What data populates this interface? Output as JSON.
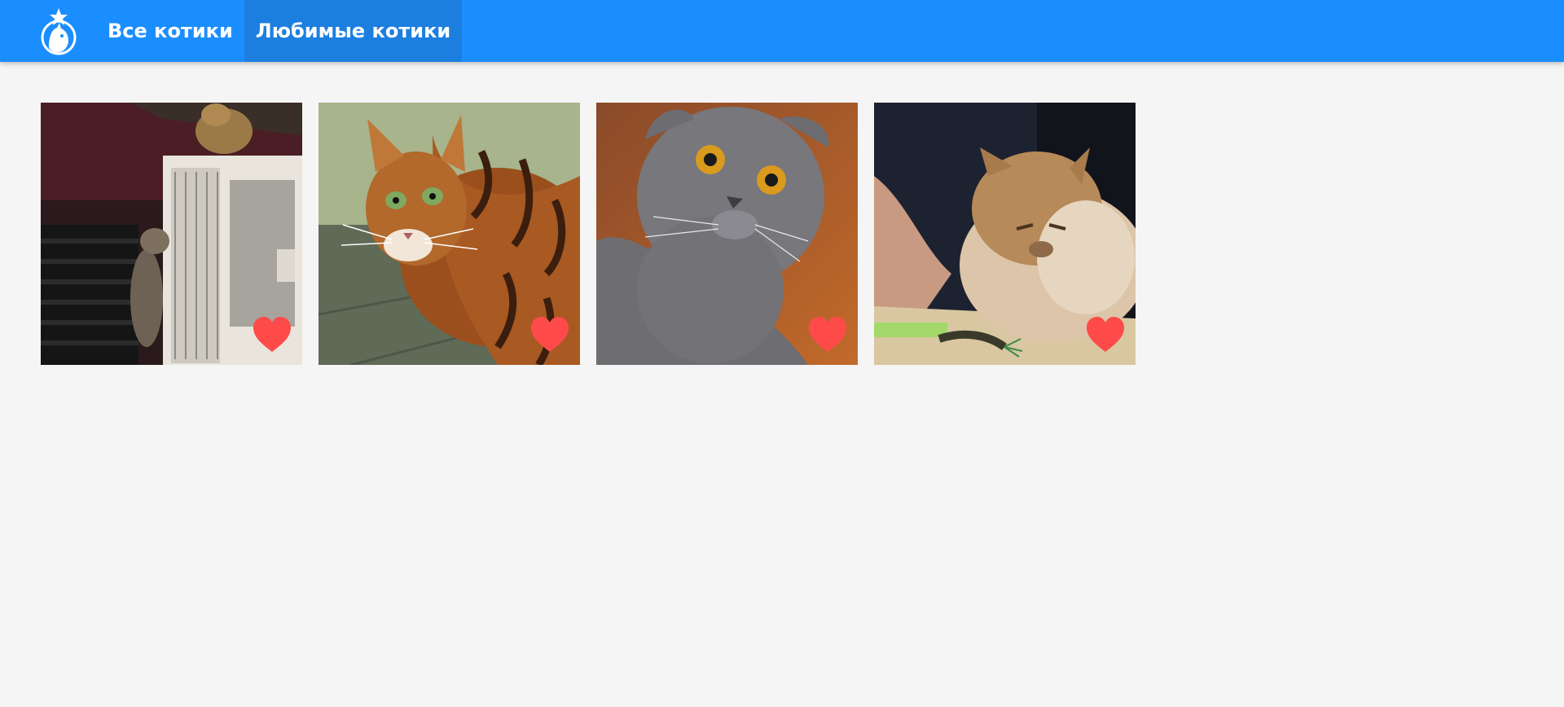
{
  "header": {
    "logo_icon": "cat-dog-star-logo-icon",
    "tabs": [
      {
        "label": "Все котики",
        "active": false
      },
      {
        "label": "Любимые котики",
        "active": true
      }
    ]
  },
  "colors": {
    "header_bg": "#1b8eff",
    "active_tab_bg": "#1c7fe0",
    "heart": "#ff4a4a",
    "page_bg": "#f5f5f5"
  },
  "cats": [
    {
      "image_icon": "cat-photo-icon",
      "favorite": true,
      "favorite_icon": "heart-icon"
    },
    {
      "image_icon": "cat-photo-icon",
      "favorite": true,
      "favorite_icon": "heart-icon"
    },
    {
      "image_icon": "cat-photo-icon",
      "favorite": true,
      "favorite_icon": "heart-icon"
    },
    {
      "image_icon": "cat-photo-icon",
      "favorite": true,
      "favorite_icon": "heart-icon"
    }
  ]
}
